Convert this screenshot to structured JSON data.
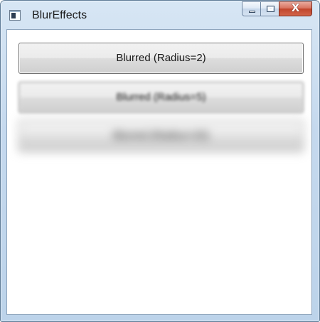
{
  "window": {
    "title": "BlurEffects",
    "app_icon": "wpf-window-icon",
    "caption_buttons": {
      "minimize_icon": "minimize-icon",
      "maximize_icon": "maximize-icon",
      "close_glyph": "X"
    }
  },
  "buttons": [
    {
      "label": "Blurred (Radius=2)"
    },
    {
      "label": "Blurred (Radius=5)"
    },
    {
      "label": "Blurred (Radius=20)"
    }
  ],
  "colors": {
    "close_button": "#c1452c",
    "frame": "#c5d9ee",
    "button_face": "#dddddd"
  }
}
